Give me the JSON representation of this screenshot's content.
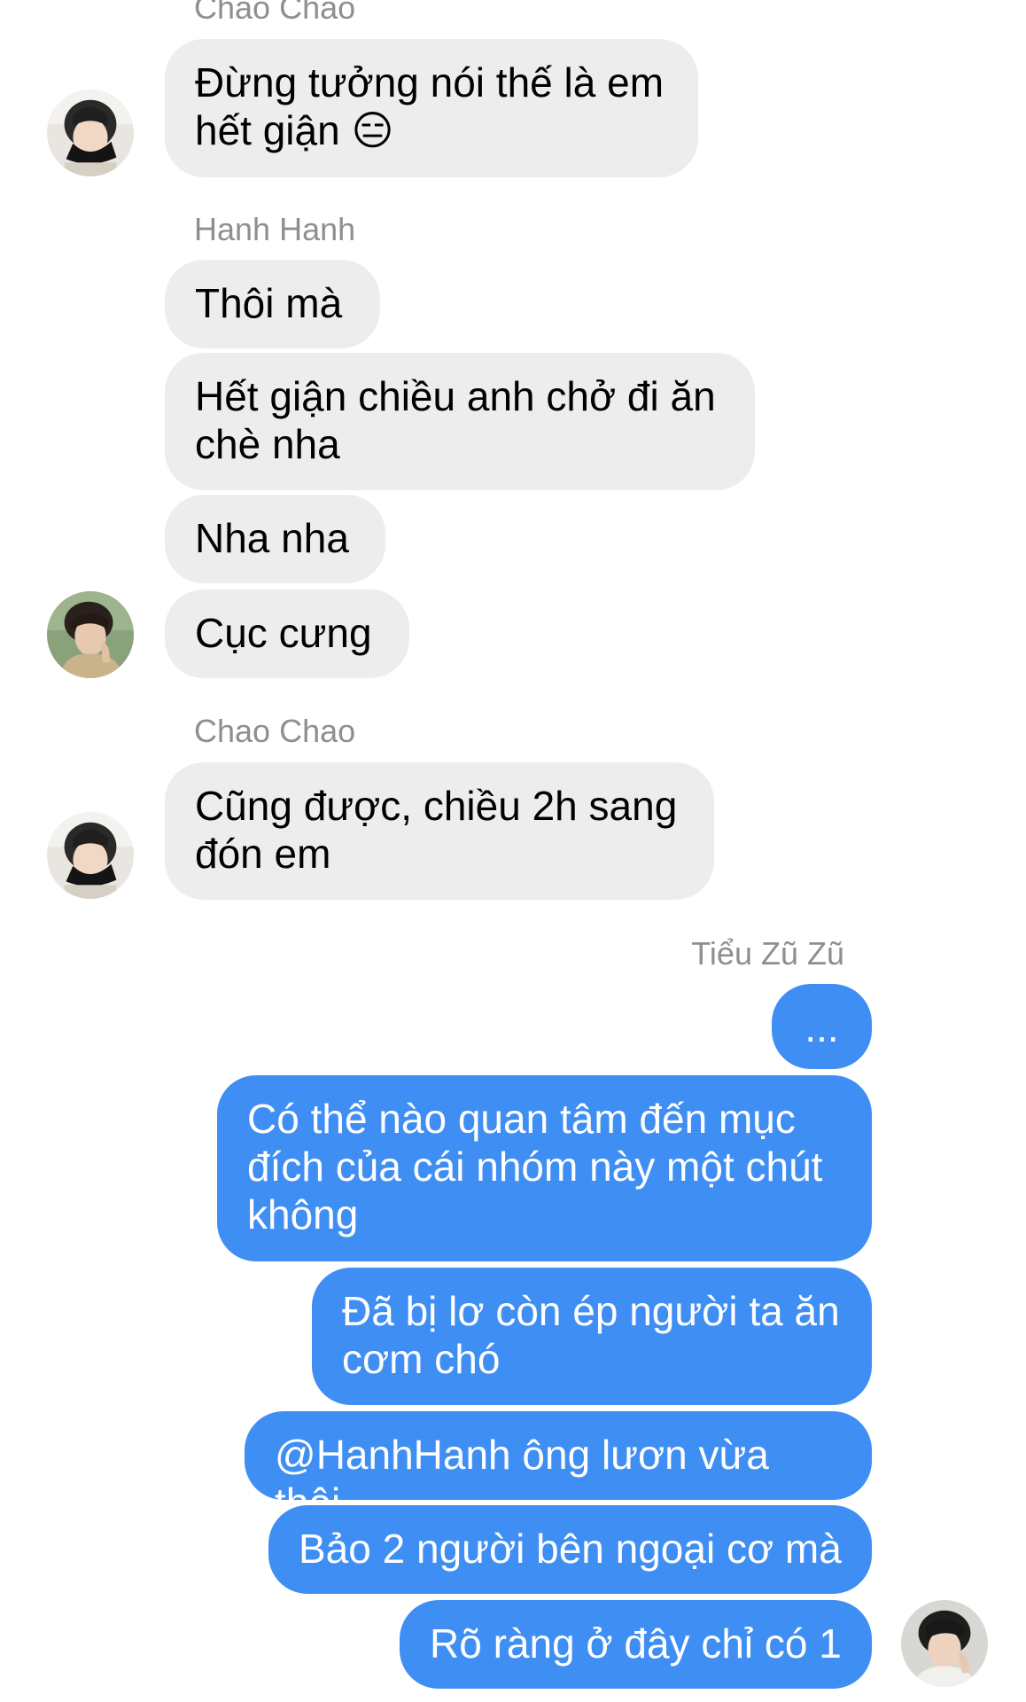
{
  "thread": {
    "incoming": [
      {
        "sender": "Chao Chao",
        "messages": [
          "Đừng tưởng nói thế là em\nhết giận 😑"
        ]
      },
      {
        "sender": "Hanh Hanh",
        "messages": [
          "Thôi mà",
          "Hết giận chiều anh chở đi ăn\nchè nha",
          "Nha nha",
          "Cục cưng"
        ]
      },
      {
        "sender": "Chao Chao",
        "messages": [
          "Cũng được, chiều 2h sang\nđón em"
        ]
      }
    ],
    "outgoing": {
      "sender": "Tiểu Zũ Zũ",
      "messages": [
        "...",
        "Có thể nào quan tâm đến mục\nđích của cái nhóm này một chút\nkhông",
        "Đã bị lơ còn ép người ta ăn\ncơm chó",
        "@HanhHanh ông lươn vừa thôi",
        "Bảo 2 người bên ngoại cơ mà",
        "Rõ ràng ở đây chỉ có 1"
      ]
    }
  },
  "colors": {
    "incoming_bubble": "#ededed",
    "outgoing_bubble": "#3f8ef4",
    "sender_name": "#8e8e93"
  },
  "icons": {
    "avatar_chao": "avatar-icon",
    "avatar_hanh": "avatar-icon",
    "avatar_self": "avatar-icon"
  }
}
